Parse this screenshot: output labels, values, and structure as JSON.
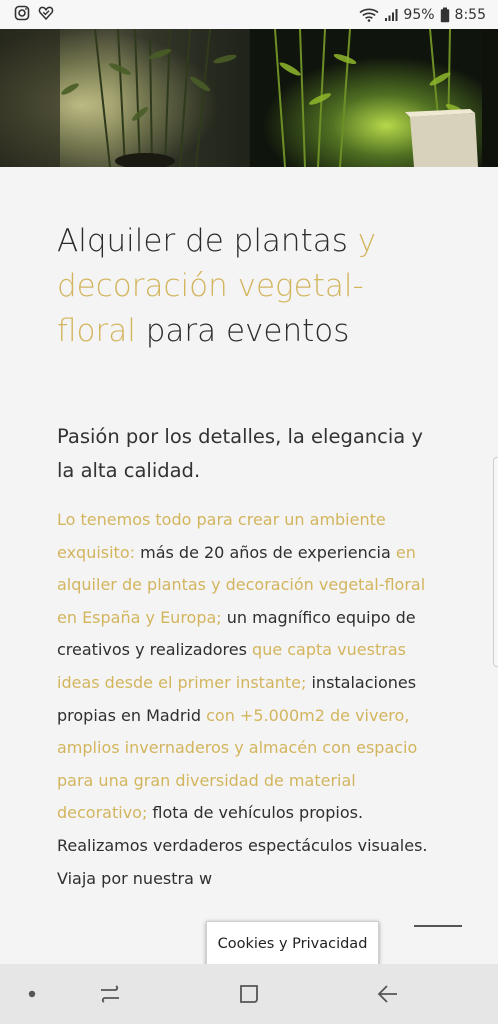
{
  "status_bar": {
    "left_icons": [
      "instagram-icon",
      "heart-check-icon"
    ],
    "battery_percent": "95%",
    "time": "8:55",
    "right_icons": [
      "wifi-icon",
      "signal-icon",
      "battery-icon"
    ]
  },
  "hero": {
    "icon": "plants-photo"
  },
  "article": {
    "headline": {
      "part1": "Alquiler de plantas ",
      "part2": "y decoración vegetal-floral",
      "part3": " para eventos"
    },
    "subheadline": "Pasión por los detalles, la elegancia y la alta calidad.",
    "body": [
      {
        "text": "Lo tenemos todo para crear un ambiente exquisito:",
        "highlight": true
      },
      {
        "text": " más de 20 años de experiencia ",
        "highlight": false
      },
      {
        "text": "en alquiler de plantas y decoración vegetal-floral en España y Europa;",
        "highlight": true
      },
      {
        "text": " un magnífico equipo de creativos y realizadores ",
        "highlight": false
      },
      {
        "text": "que capta vuestras ideas desde el primer instante;",
        "highlight": true
      },
      {
        "text": " instalaciones propias en Madrid ",
        "highlight": false
      },
      {
        "text": "con +5.000m2 de vivero, amplios invernaderos y almacén con espacio para una gran diversidad de material decorativo;",
        "highlight": true
      },
      {
        "text": " flota de vehículos propios. Realizamos verdaderos espectáculos visuales.",
        "highlight": false
      }
    ],
    "truncated_line": "Viaja por nuestra w"
  },
  "cookie_button": {
    "label": "Cookies y Privacidad"
  },
  "nav_bar": {
    "icons": [
      "dot-icon",
      "recent-apps-icon",
      "home-icon",
      "back-icon"
    ]
  },
  "colors": {
    "accent": "#d3b55e",
    "text": "#2b2b2b",
    "background": "#f4f4f4"
  }
}
